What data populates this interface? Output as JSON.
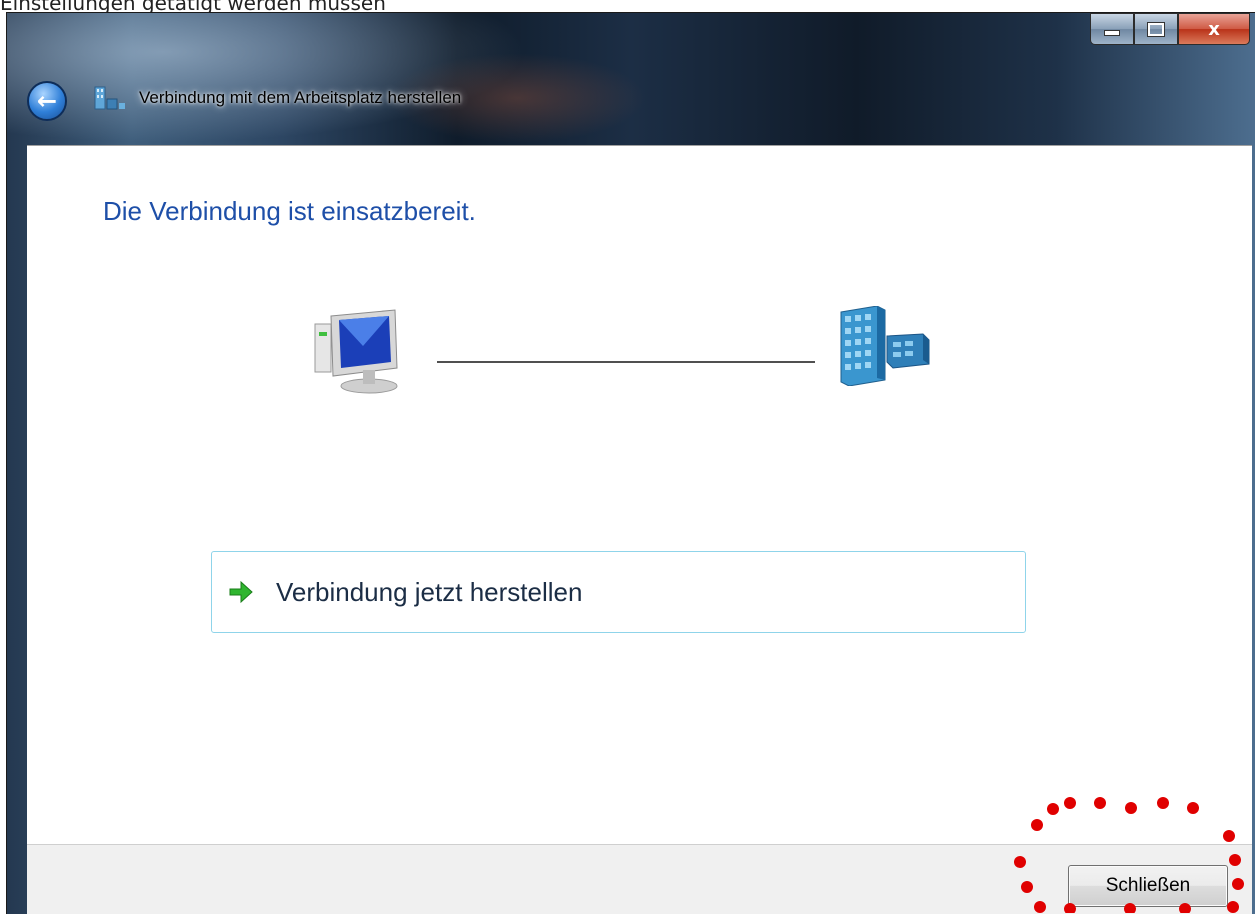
{
  "caption_text": "Einstellungen getätigt werden müssen",
  "window": {
    "title": "Verbindung mit dem Arbeitsplatz herstellen",
    "close_glyph": "x"
  },
  "content": {
    "heading": "Die Verbindung ist einsatzbereit.",
    "link_label": "Verbindung jetzt herstellen"
  },
  "footer": {
    "close_button_label": "Schließen"
  },
  "colors": {
    "heading": "#1e4fa8",
    "link_border": "#8fd4ea",
    "annotation": "#e00000"
  },
  "icons": {
    "back": "back-arrow-icon",
    "title": "network-workplace-icon",
    "computer": "computer-icon",
    "building": "office-building-icon",
    "link_arrow": "green-arrow-icon"
  }
}
